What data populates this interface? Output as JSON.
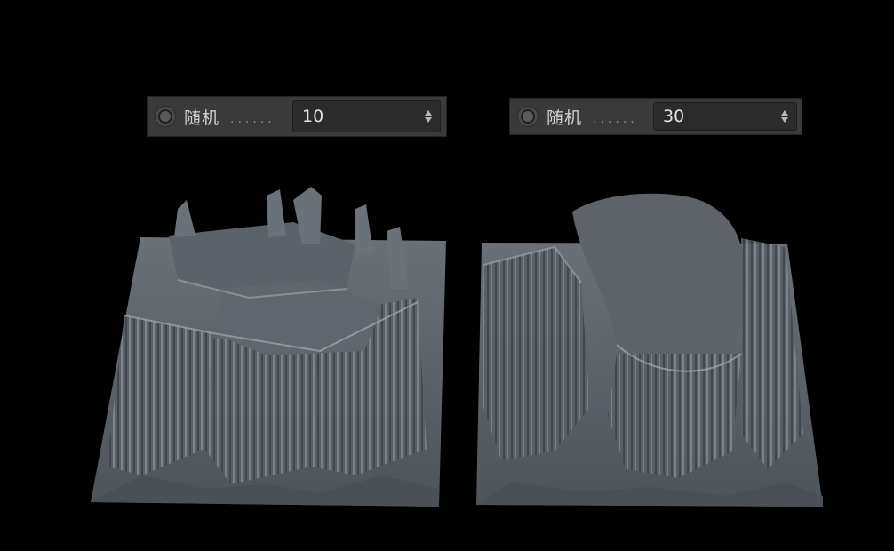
{
  "params": [
    {
      "label": "随机",
      "dots": "......",
      "value": "10",
      "animation_icon": "keyframe-circle-icon",
      "stepper_icon": "up-down-stepper-icon"
    },
    {
      "label": "随机",
      "dots": "......",
      "value": "30",
      "animation_icon": "keyframe-circle-icon",
      "stepper_icon": "up-down-stepper-icon"
    }
  ],
  "colors": {
    "background": "#000000",
    "panel": "#3a3a3a",
    "field": "#2b2b2b",
    "terrain_base": "#5b6168",
    "terrain_highlight": "#9aa1a8",
    "terrain_shadow": "#2f3439"
  }
}
